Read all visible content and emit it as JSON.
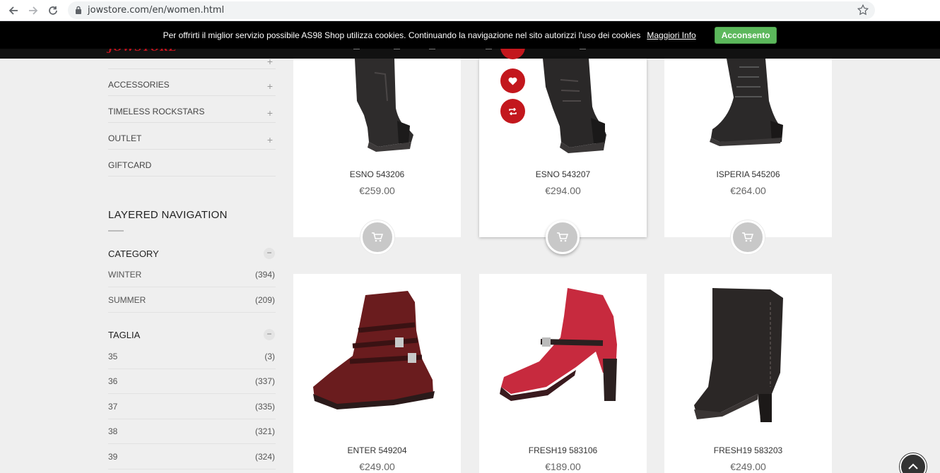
{
  "browser": {
    "url": "jowstore.com/en/women.html"
  },
  "site": {
    "logo_text": "JOWSTORE"
  },
  "cookie": {
    "message": "Per offrirti il miglior servizio possibile AS98 Shop utilizza cookies. Continuando la navigazione nel sito autorizzi l'uso dei cookies",
    "more_info": "Maggiori Info",
    "accept": "Acconsento"
  },
  "sidebar": {
    "menu": [
      {
        "label": "ACCESSORIES",
        "has_children": true
      },
      {
        "label": "TIMELESS ROCKSTARS",
        "has_children": true
      },
      {
        "label": "OUTLET",
        "has_children": true
      },
      {
        "label": "GIFTCARD",
        "has_children": false
      }
    ],
    "layered_title": "LAYERED NAVIGATION",
    "category": {
      "title": "CATEGORY",
      "items": [
        {
          "label": "WINTER",
          "count": "(394)"
        },
        {
          "label": "SUMMER",
          "count": "(209)"
        }
      ]
    },
    "taglia": {
      "title": "TAGLIA",
      "items": [
        {
          "label": "35",
          "count": "(3)"
        },
        {
          "label": "36",
          "count": "(337)"
        },
        {
          "label": "37",
          "count": "(335)"
        },
        {
          "label": "38",
          "count": "(321)"
        },
        {
          "label": "39",
          "count": "(324)"
        }
      ]
    }
  },
  "products": [
    {
      "name": "ESNO 543206",
      "price": "€259.00",
      "color": "#2e2c2c"
    },
    {
      "name": "ESNO 543207",
      "price": "€294.00",
      "color": "#2a2828"
    },
    {
      "name": "ISPERIA 545206",
      "price": "€264.00",
      "color": "#2b2929"
    },
    {
      "name": "ENTER 549204",
      "price": "€249.00",
      "color": "#6a1c1e"
    },
    {
      "name": "FRESH19 583106",
      "price": "€189.00",
      "color": "#c72a3e"
    },
    {
      "name": "FRESH19 583203",
      "price": "€249.00",
      "color": "#2b2726"
    }
  ],
  "icons": {
    "back": "arrow-left-icon",
    "forward": "arrow-right-icon",
    "reload": "reload-icon",
    "lock": "lock-icon",
    "bookmark": "star-icon",
    "cart": "cart-icon",
    "wishlist": "heart-icon",
    "compare": "compare-icon",
    "scroll_top": "chevron-up-icon"
  }
}
